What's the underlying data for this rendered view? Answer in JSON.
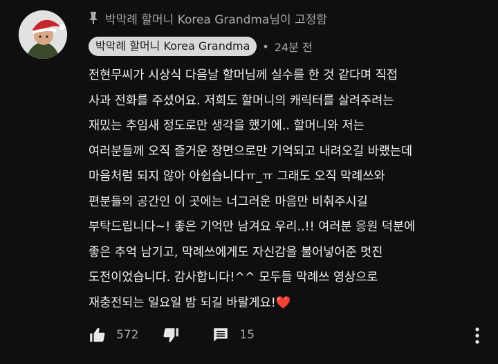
{
  "pinned": {
    "label": "박막례 할머니 Korea Grandma님이 고정함"
  },
  "comment": {
    "author": "박막례 할머니 Korea Grandma",
    "separator": "•",
    "time": "24분 전",
    "lines": [
      "전현무씨가 시상식 다음날 할머님께 실수를 한 것 같다며 직접",
      "사과 전화를 주셨어요. 저희도 할머니의 캐릭터를 살려주려는",
      "재밌는 추임새 정도로만 생각을 했기에.. 할머니와 저는",
      "여러분들께 오직 즐거운 장면으로만 기억되고 내려오길 바랬는데",
      "마음처럼 되지 않아 아쉽습니다ㅠ_ㅠ 그래도  오직 막례쓰와",
      "편분들의 공간인 이 곳에는 너그러운 마음만 비춰주시길",
      "부탁드립니다~! 좋은 기억만 남겨요 우리..!! 여러분 응원 덕분에",
      "좋은 추억 남기고, 막례쓰에게도 자신감을 불어넣어준 멋진",
      "도전이었습니다. 감사합니다!^^ 모두들 막례쓰 영상으로",
      "재충전되는 일요일 밤 되길 바랄게요!"
    ],
    "emoji": "❤️"
  },
  "actions": {
    "like_count": "572",
    "reply_count": "15"
  },
  "icons": {
    "pin": "pin-icon",
    "like": "thumbs-up-icon",
    "dislike": "thumbs-down-icon",
    "reply": "reply-comment-icon",
    "more": "more-vertical-icon"
  },
  "colors": {
    "background": "#0f0f0f",
    "text": "#f1f1f1",
    "muted": "#aaaaaa",
    "chip": "#d9d9d9",
    "heart": "#ff3b4a"
  }
}
